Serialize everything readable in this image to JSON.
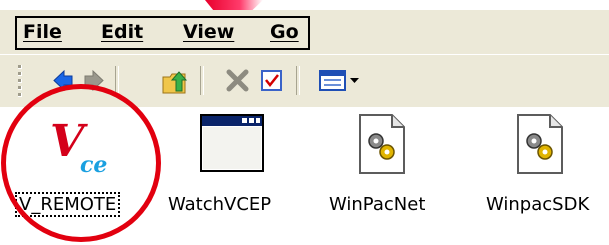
{
  "menu": {
    "items": [
      {
        "label": "File"
      },
      {
        "label": "Edit"
      },
      {
        "label": "View"
      },
      {
        "label": "Go"
      }
    ]
  },
  "toolbar": {
    "buttons": [
      {
        "icon": "back-arrow-icon"
      },
      {
        "icon": "forward-arrow-icon"
      },
      {
        "icon": "up-folder-icon"
      },
      {
        "icon": "delete-x-icon"
      },
      {
        "icon": "properties-icon"
      },
      {
        "icon": "views-icon"
      }
    ]
  },
  "files": [
    {
      "label": "V_REMOTE",
      "icon": "vce-icon",
      "icon_text": "ce",
      "selected": true
    },
    {
      "label": "WatchVCEP",
      "icon": "application-window-icon"
    },
    {
      "label": "WinPacNet",
      "icon": "system-file-gears-icon"
    },
    {
      "label": "WinpacSDK",
      "icon": "system-file-gears-icon"
    }
  ],
  "colors": {
    "chrome": "#ece9d8",
    "highlight_circle": "#e2000f",
    "back_arrow": "#1a66e6",
    "vce_red": "#d4001a",
    "vce_blue": "#1aa0e0"
  }
}
